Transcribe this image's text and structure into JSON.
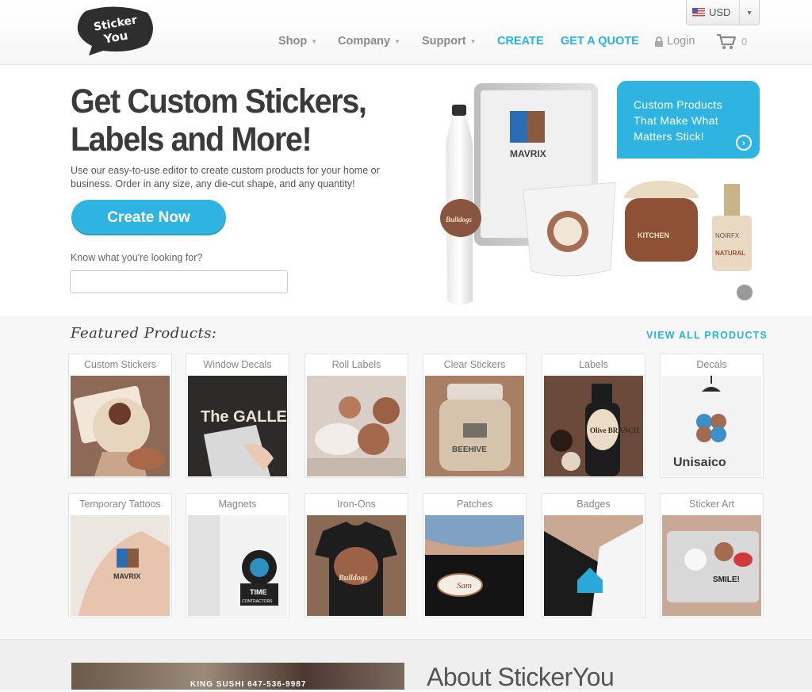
{
  "brand": {
    "logo_line1": "Sticker",
    "logo_line2": "You"
  },
  "currency": {
    "label": "USD"
  },
  "nav": {
    "shop": "Shop",
    "company": "Company",
    "support": "Support",
    "create": "CREATE",
    "quote": "GET A QUOTE",
    "login": "Login",
    "cart_count": "0"
  },
  "hero": {
    "title": "Get Custom Stickers, Labels and More!",
    "subtitle": "Use our easy-to-use editor to create custom products for your home or business. Order in any size, any die-cut shape, and any quantity!",
    "cta": "Create Now",
    "search_label": "Know what you're looking for?",
    "search_value": "",
    "promo": "Custom Products That Make What Matters Stick!",
    "img_mavrix": "MAVRIX",
    "img_bulldogs": "Bulldogs",
    "img_kitchen": "KITCHEN",
    "img_noirfx": "NOIRFX",
    "img_natural": "NATURAL"
  },
  "featured": {
    "title": "Featured Products:",
    "view_all": "VIEW ALL PRODUCTS",
    "products": [
      {
        "label": "Custom Stickers"
      },
      {
        "label": "Window Decals"
      },
      {
        "label": "Roll Labels"
      },
      {
        "label": "Clear Stickers"
      },
      {
        "label": "Labels"
      },
      {
        "label": "Decals"
      },
      {
        "label": "Temporary Tattoos"
      },
      {
        "label": "Magnets"
      },
      {
        "label": "Iron-Ons"
      },
      {
        "label": "Patches"
      },
      {
        "label": "Badges"
      },
      {
        "label": "Sticker Art"
      }
    ],
    "img_text": {
      "gallery": "The GALLERY",
      "beehive": "BEEHIVE",
      "olive": "Olive BRANCH",
      "unisaico": "Unisaico",
      "mavrix": "MAVRIX",
      "time": "TIME",
      "contractors": "CONTRACTORS",
      "bulldogs": "Bulldogs",
      "sam": "Sam",
      "smile": "SMILE!"
    }
  },
  "about": {
    "title": "About StickerYou",
    "photo_text": "KING SUSHI 647-536-9987"
  },
  "colors": {
    "accent": "#2fb4e1",
    "nav_gray": "#8a8a8a",
    "title": "#3a3a3a"
  }
}
